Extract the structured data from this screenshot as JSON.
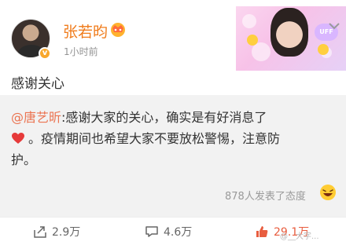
{
  "post": {
    "username": "张若昀",
    "time": "1小时前",
    "text": "感谢关心",
    "banner_tag": "UFF"
  },
  "repost": {
    "mention": "@唐艺昕",
    "line1": ":感谢大家的关心，确实是有好消息了",
    "line2": "。疫情期间也希望大家不要放松警惕，注意防",
    "line3": "护。"
  },
  "reactions": {
    "summary": "878人发表了态度"
  },
  "actions": {
    "share_count": "2.9万",
    "comment_count": "4.6万",
    "like_count": "29.1万"
  },
  "watermark": "@__大字..."
}
